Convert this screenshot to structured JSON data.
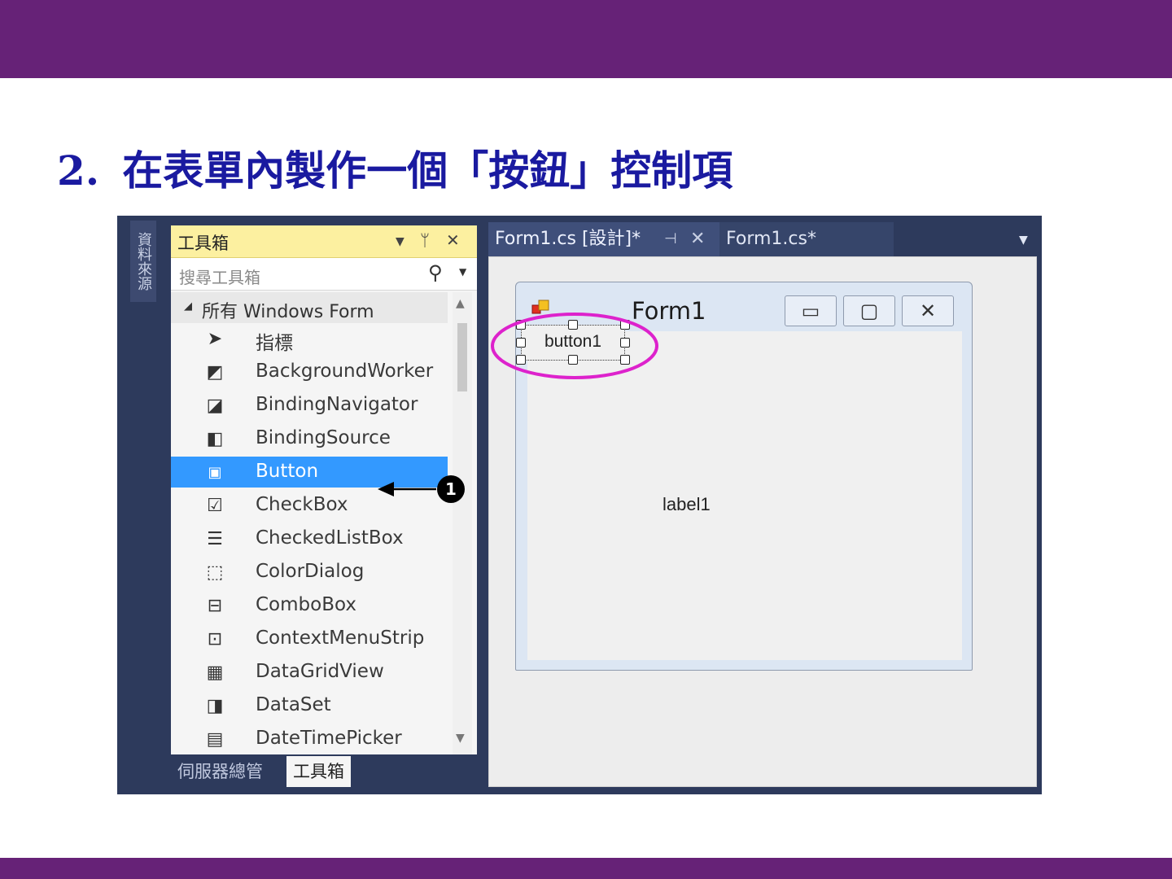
{
  "slide": {
    "number": "2.",
    "title": "在表單內製作一個「按鈕」控制項"
  },
  "ide": {
    "side_tab": "資料來源",
    "toolbox": {
      "title": "工具箱",
      "search_placeholder": "搜尋工具箱",
      "group": "所有 Windows Form",
      "items": [
        {
          "label": "指標",
          "icon": "pointer-icon"
        },
        {
          "label": "BackgroundWorker",
          "icon": "background-worker-icon"
        },
        {
          "label": "BindingNavigator",
          "icon": "binding-navigator-icon"
        },
        {
          "label": "BindingSource",
          "icon": "binding-source-icon"
        },
        {
          "label": "Button",
          "icon": "button-control-icon",
          "selected": true
        },
        {
          "label": "CheckBox",
          "icon": "checkbox-icon"
        },
        {
          "label": "CheckedListBox",
          "icon": "checked-listbox-icon"
        },
        {
          "label": "ColorDialog",
          "icon": "color-dialog-icon"
        },
        {
          "label": "ComboBox",
          "icon": "combobox-icon"
        },
        {
          "label": "ContextMenuStrip",
          "icon": "context-menu-strip-icon"
        },
        {
          "label": "DataGridView",
          "icon": "datagridview-icon"
        },
        {
          "label": "DataSet",
          "icon": "dataset-icon"
        },
        {
          "label": "DateTimePicker",
          "icon": "datetimepicker-icon"
        }
      ],
      "annotation_number": "1"
    },
    "bottom_tabs": {
      "server_explorer": "伺服器總管",
      "toolbox": "工具箱"
    },
    "doc_tabs": {
      "design": "Form1.cs [設計]*",
      "code": "Form1.cs*"
    },
    "form": {
      "title": "Form1",
      "button_text": "button1",
      "label_text": "label1"
    },
    "colors": {
      "accent_band": "#662277",
      "title_text": "#1a1aa0",
      "selection": "#3399ff",
      "highlight_ellipse": "#dd22cc"
    }
  }
}
